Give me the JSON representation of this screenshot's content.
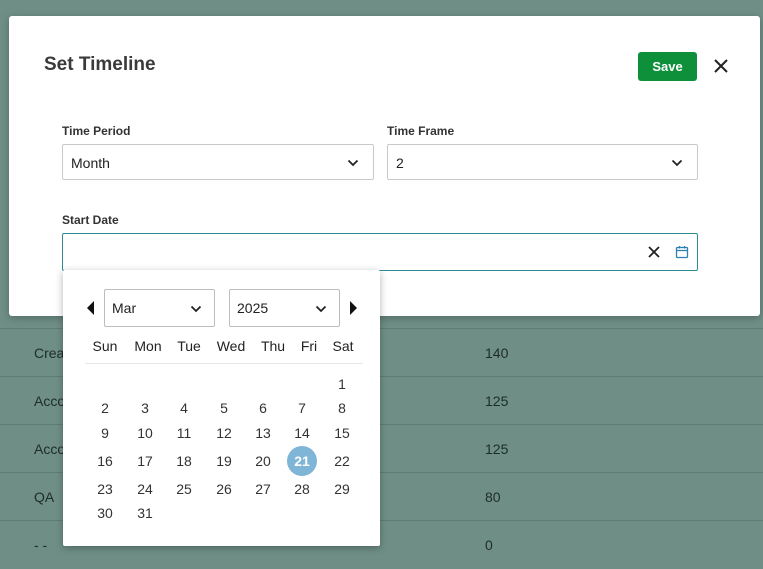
{
  "background_rows": [
    {
      "name": "Crea",
      "value": "140"
    },
    {
      "name": "Acco",
      "value": "125"
    },
    {
      "name": "Acco",
      "value": "125"
    },
    {
      "name": "QA",
      "value": "80"
    },
    {
      "name": "- -",
      "value": "0"
    }
  ],
  "modal": {
    "title": "Set Timeline",
    "save_label": "Save",
    "close_icon": "close-icon",
    "time_period": {
      "label": "Time Period",
      "value": "Month"
    },
    "time_frame": {
      "label": "Time Frame",
      "value": "2"
    },
    "start_date": {
      "label": "Start Date",
      "value": ""
    }
  },
  "calendar": {
    "month": "Mar",
    "year": "2025",
    "weekdays": [
      "Sun",
      "Mon",
      "Tue",
      "Wed",
      "Thu",
      "Fri",
      "Sat"
    ],
    "weeks": [
      [
        "",
        "",
        "",
        "",
        "",
        "",
        "1"
      ],
      [
        "2",
        "3",
        "4",
        "5",
        "6",
        "7",
        "8"
      ],
      [
        "9",
        "10",
        "11",
        "12",
        "13",
        "14",
        "15"
      ],
      [
        "16",
        "17",
        "18",
        "19",
        "20",
        "21",
        "22"
      ],
      [
        "23",
        "24",
        "25",
        "26",
        "27",
        "28",
        "29"
      ],
      [
        "30",
        "31",
        "",
        "",
        "",
        "",
        ""
      ]
    ],
    "selected_day": "21",
    "selected_color": "#7fb5d6"
  },
  "colors": {
    "save_button": "#0e8f3a",
    "date_focus_border": "#2f8a97",
    "overlay": "#6f8f86"
  }
}
